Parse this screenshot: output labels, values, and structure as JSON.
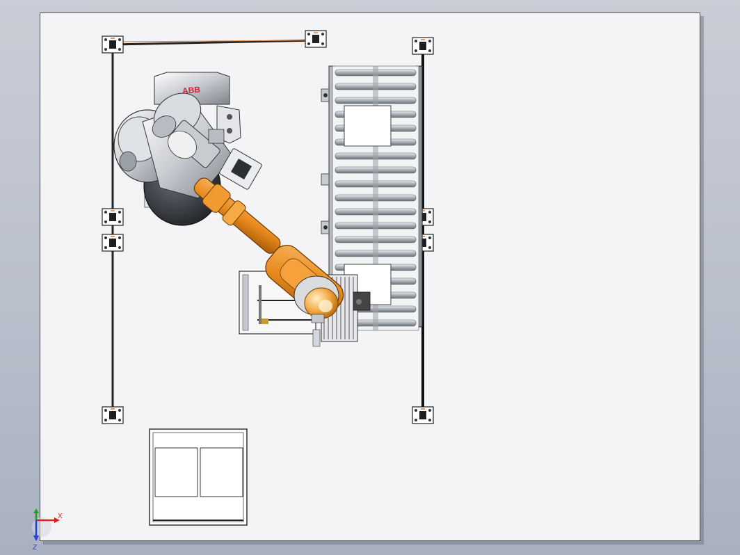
{
  "view": {
    "background_top": "#c9cdd6",
    "background_bottom": "#a9b0bf",
    "sheet_color": "#f4f4f6"
  },
  "robot": {
    "brand_mark": "ABB",
    "arm_color": "#e8891c",
    "base_color": "#d7d9dc"
  },
  "triad": {
    "x_label": "X",
    "z_label": "Z",
    "x_color": "#e02020",
    "y_color": "#20a020",
    "z_color": "#2040e0"
  }
}
